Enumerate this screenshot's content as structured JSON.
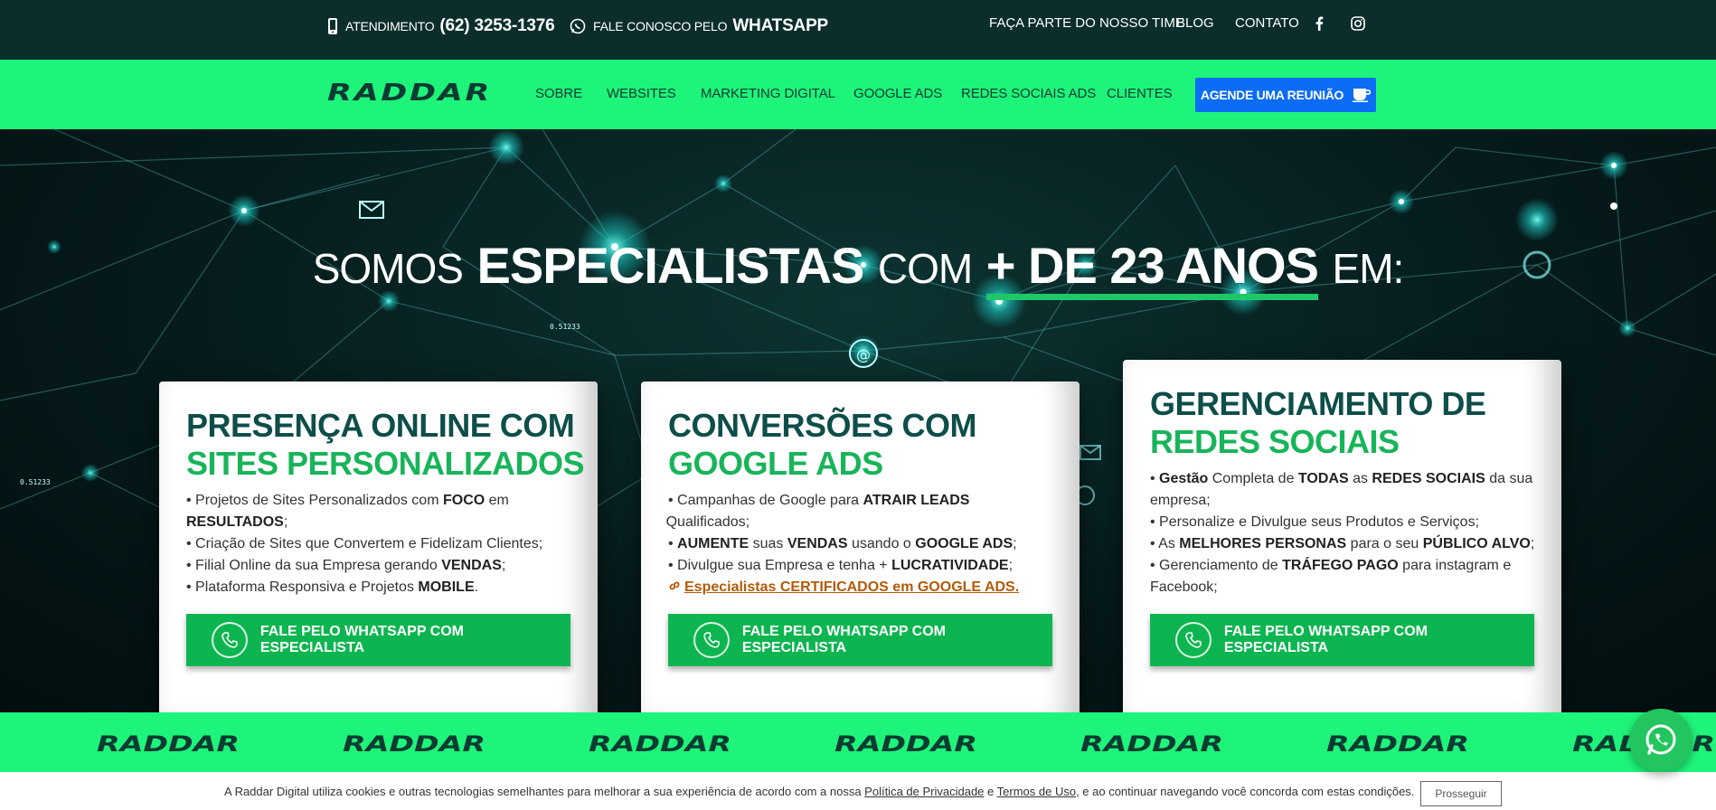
{
  "topbar": {
    "phone_label": "ATENDIMENTO",
    "phone_number": "(62) 3253-1376",
    "whatsapp_label": "FALE CONOSCO PELO",
    "whatsapp_strong": "WHATSAPP",
    "links": [
      "FAÇA PARTE DO NOSSO TIME",
      "BLOG",
      "CONTATO"
    ],
    "social": [
      "facebook-icon",
      "instagram-icon"
    ]
  },
  "nav": {
    "logo": "RADDAR",
    "items": [
      "SOBRE",
      "WEBSITES",
      "MARKETING DIGITAL",
      "GOOGLE ADS",
      "REDES SOCIAIS ADS",
      "CLIENTES"
    ],
    "cta": "AGENDE UMA REUNIÃO"
  },
  "hero": {
    "h1": "SOMOS",
    "h2": "ESPECIALISTAS",
    "h3": "COM",
    "h4": "+ DE 23 ANOS",
    "h5": "EM:",
    "readouts": [
      "0.51233",
      "0.51233"
    ]
  },
  "cards": [
    {
      "title_dark": "PRESENÇA ONLINE COM",
      "title_green": "SITES PERSONALIZADOS",
      "items": [
        {
          "a": "Projetos de Sites Personalizados com ",
          "b": "FOCO",
          "c": " em "
        },
        {
          "a": "",
          "b": "RESULTADOS",
          "c": ";"
        },
        {
          "a": "Criação de Sites que Convertem e Fidelizam Clientes;",
          "b": "",
          "c": ""
        },
        {
          "a": "Filial Online da sua Empresa gerando ",
          "b": "VENDAS",
          "c": ";"
        },
        {
          "a": "Plataforma Responsiva e Projetos ",
          "b": "MOBILE",
          "c": "."
        }
      ],
      "button": "FALE PELO WHATSAPP COM ESPECIALISTA"
    },
    {
      "title_dark": "CONVERSÕES COM",
      "title_green": "GOOGLE ADS",
      "items": [
        {
          "a": "Campanhas de Google para ",
          "b": "ATRAIR LEADS",
          "c": ""
        },
        {
          "a": "Qualificados;",
          "b": "",
          "c": ""
        },
        {
          "a": "",
          "b": "AUMENTE",
          "c": " suas "
        },
        {
          "a": "Divulgue sua Empresa e tenha + ",
          "b": "LUCRATIVIDADE",
          "c": ";"
        }
      ],
      "item3_b2": "VENDAS",
      "item3_mid": " usando o ",
      "item3_b3": "GOOGLE ADS",
      "item3_end": ";",
      "link": "Especialistas CERTIFICADOS em GOOGLE ADS.",
      "button": "FALE PELO WHATSAPP COM ESPECIALISTA"
    },
    {
      "title_dark": "GERENCIAMENTO DE",
      "title_green": "REDES SOCIAIS",
      "items": [
        {
          "a": "",
          "b": "Gestão",
          "c": " Completa de "
        },
        {
          "a": "Personalize e Divulgue seus Produtos e Serviços;",
          "b": "",
          "c": ""
        },
        {
          "a": "As ",
          "b": "MELHORES PERSONAS",
          "c": " para o seu "
        },
        {
          "a": "Gerenciamento de ",
          "b": "TRÁFEGO PAGO",
          "c": " para instagram e"
        }
      ],
      "item1_b2": "TODAS",
      "item1_mid": " as ",
      "item1_b3": "REDES SOCIAIS",
      "item1_end": " da sua",
      "item1_line2": "empresa;",
      "item3_b2": "PÚBLICO ALVO",
      "item3_end": ";",
      "item4_line2": "Facebook;",
      "button": "FALE PELO WHATSAPP COM ESPECIALISTA"
    }
  ],
  "marquee": {
    "logo": "RADDAR"
  },
  "cookie": {
    "text_before": "A Raddar Digital utiliza cookies e outras tecnologias semelhantes para melhorar a sua experiência de acordo com a nossa ",
    "privacy": "Política de Privacidade",
    "and": " e ",
    "terms": "Termos de Uso",
    "text_after": ", e ao continuar navegando você concorda com estas condições.",
    "button": "Prosseguir"
  },
  "colors": {
    "nav_green": "#1ef47a",
    "dark_teal": "#0b2e2c",
    "button_green": "#0db550",
    "cta_blue": "#0b6cf5"
  }
}
